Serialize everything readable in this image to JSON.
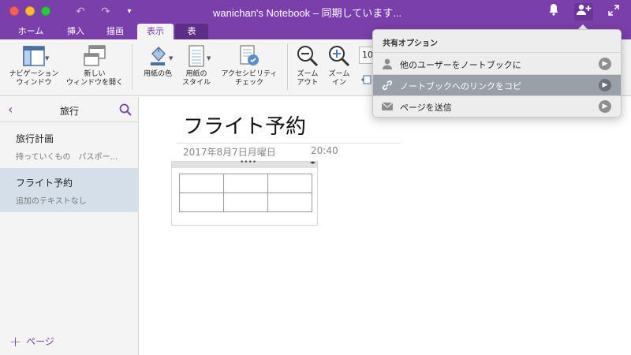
{
  "window": {
    "title": "wanichan's Notebook – 同期しています..."
  },
  "tabs": [
    {
      "label": "ホーム"
    },
    {
      "label": "挿入"
    },
    {
      "label": "描画"
    },
    {
      "label": "表示"
    },
    {
      "label": "表"
    }
  ],
  "ribbon": {
    "nav_window": "ナビゲーション\nウィンドウ",
    "new_window": "新しい\nウィンドウを開く",
    "paper_color": "用紙の色",
    "paper_style": "用紙の\nスタイル",
    "accessibility": "アクセシビリティ\nチェック",
    "zoom_out": "ズーム\nアウト",
    "zoom_in": "ズーム\nイン",
    "zoom_value": "10"
  },
  "sidebar": {
    "section_title": "旅行",
    "pages": [
      {
        "title": "旅行計画",
        "preview": "持っていくもの　パスポー..."
      },
      {
        "title": "フライト予約",
        "preview": "追加のテキストなし"
      }
    ],
    "add_page": "ページ"
  },
  "page": {
    "title": "フライト予約",
    "date": "2017年8月7日月曜日",
    "time": "20:40",
    "table_handle_dots": "••••",
    "table_handle_arrows": "◂▸"
  },
  "share_popup": {
    "heading": "共有オプション",
    "items": [
      {
        "label": "他のユーザーをノートブックに"
      },
      {
        "label": "ノートブックへのリンクをコピ"
      },
      {
        "label": "ページを送信"
      }
    ]
  },
  "colors": {
    "accent": "#7a3fab",
    "selected_page": "#d5dfe9",
    "highlight_row": "#9aa0a8"
  }
}
